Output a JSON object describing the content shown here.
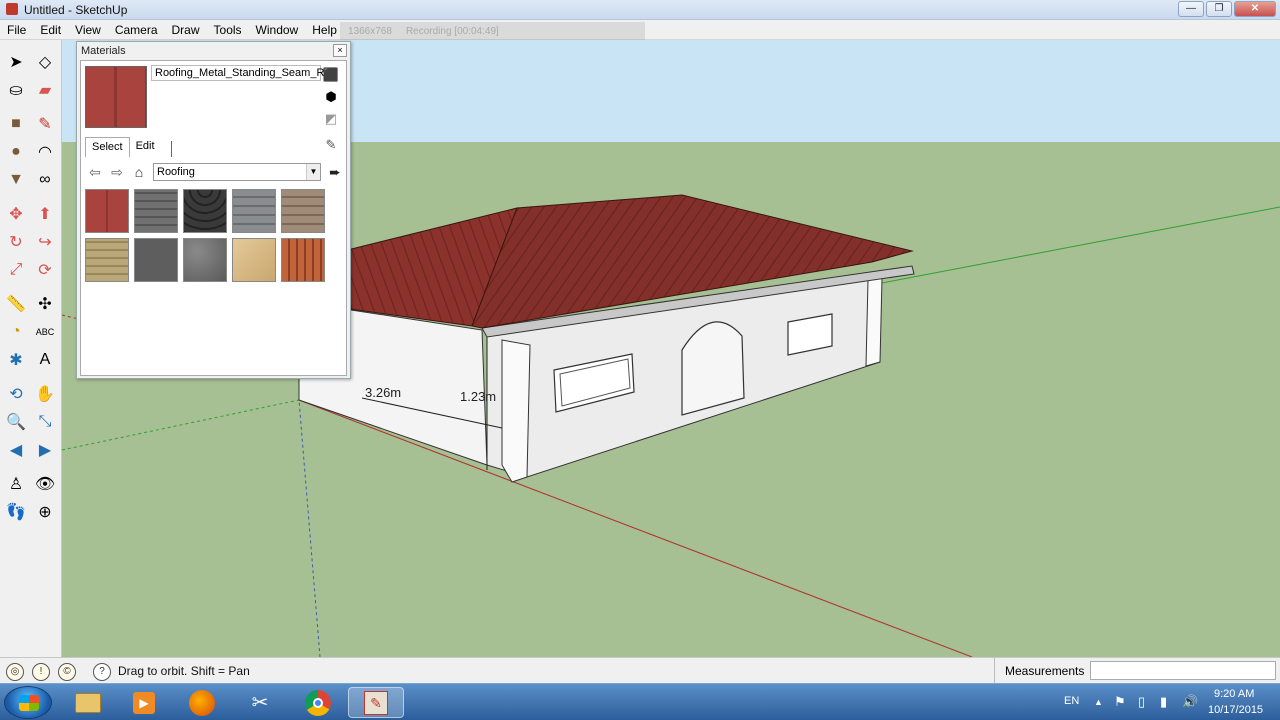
{
  "window": {
    "title": "Untitled - SketchUp",
    "recording_resolution": "1366x768",
    "recording_status": "Recording [00:04:49]",
    "minimize": "—",
    "maximize": "❐",
    "close": "✕"
  },
  "menu": [
    "File",
    "Edit",
    "View",
    "Camera",
    "Draw",
    "Tools",
    "Window",
    "Help"
  ],
  "materials_panel": {
    "title": "Materials",
    "close": "×",
    "material_name": "Roofing_Metal_Standing_Seam_Red",
    "tabs": [
      "Select",
      "Edit"
    ],
    "collection": "Roofing",
    "thumbnails": [
      "roofing-metal-red",
      "roofing-shingles-gray",
      "roofing-scalloped-dark",
      "roofing-shingles-slate",
      "roofing-shingles-brown",
      "roofing-shingles-tan",
      "roofing-shingles-charcoal",
      "roofing-stone-gray",
      "roofing-slate-beige",
      "roofing-tile-terracotta"
    ]
  },
  "dimensions": {
    "length": "3.26m",
    "height": "1.23m"
  },
  "statusbar": {
    "hint": "Drag to orbit.  Shift = Pan",
    "measurements_label": "Measurements",
    "measurements_value": ""
  },
  "taskbar": {
    "language": "EN",
    "time": "9:20 AM",
    "date": "10/17/2015"
  },
  "colors": {
    "sky": "#c9e4f5",
    "ground": "#a6bf93",
    "roof": "#8c322c",
    "wall": "#f2f2f2"
  }
}
